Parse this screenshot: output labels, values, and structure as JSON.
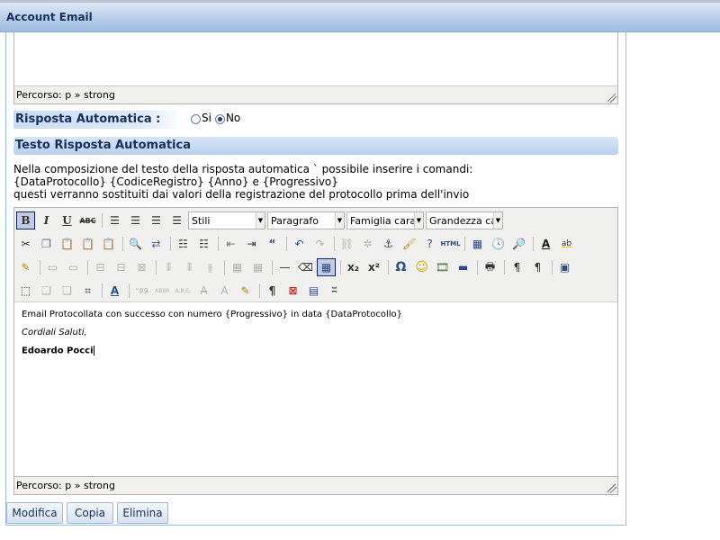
{
  "window": {
    "title": "Account Email"
  },
  "top_editor": {
    "path_label": "Percorso: p » strong"
  },
  "auto_reply": {
    "label": "Risposta Automatica :",
    "options": [
      {
        "label": "Si",
        "checked": false
      },
      {
        "label": "No",
        "checked": true
      }
    ]
  },
  "reply_text": {
    "section_title": "Testo Risposta Automatica",
    "description": [
      "Nella composizione del testo della risposta automatica ` possibile inserire i comandi:",
      "{DataProtocollo} {CodiceRegistro} {Anno} e {Progressivo}",
      "questi verranno sostituiti dai valori della registrazione del protocollo prima dell'invio"
    ]
  },
  "toolbar": {
    "style_select": "Stili",
    "format_select": "Paragrafo",
    "font_family_select": "Famiglia caratt",
    "font_size_select": "Grandezza cara",
    "bold": "B",
    "italic": "I",
    "underline": "U",
    "strikethrough": "ABC",
    "html_label": "HTML",
    "omega": "Ω",
    "text_color": "A",
    "highlight": "ab",
    "abbr": "ABBR",
    "acronym": "A.B.C.",
    "quote": "\"\"",
    "cite": "“99"
  },
  "content": {
    "line1": "Email Protocollata con successo con numero {Progressivo} in data {DataProtocollo}",
    "line2": "Cordiali Saluti,",
    "line3": "Edoardo Pocci"
  },
  "bottom_editor": {
    "path_label": "Percorso: p » strong"
  },
  "buttons": {
    "modify": "Modifica",
    "copy": "Copia",
    "delete": "Elimina"
  }
}
